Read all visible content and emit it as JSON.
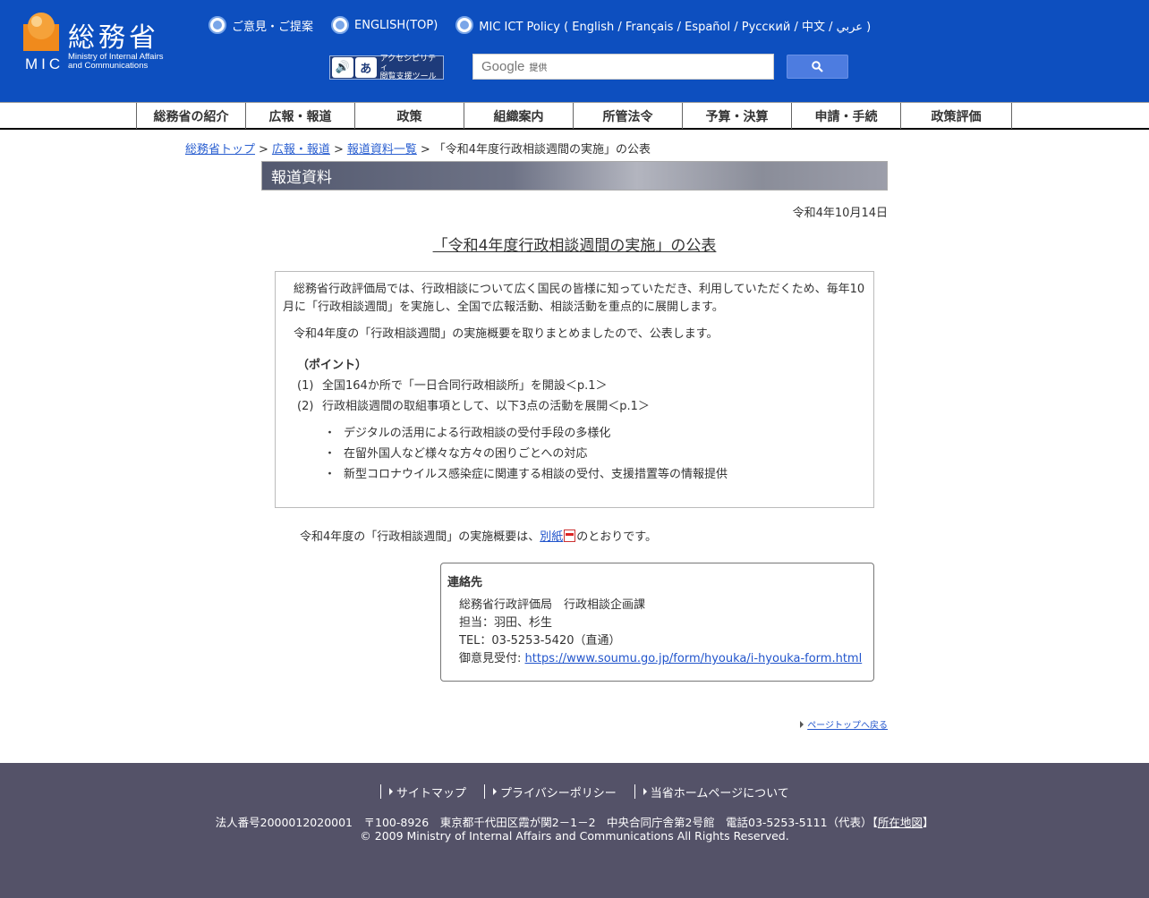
{
  "header": {
    "logo_ja": "総務省",
    "logo_mic": "MIC",
    "logo_en_line1": "Ministry of Internal Affairs",
    "logo_en_line2": "and Communications",
    "links": [
      {
        "label": "ご意見・ご提案"
      },
      {
        "label": "ENGLISH(TOP)"
      },
      {
        "label": "MIC ICT Policy ( English / Français / Español / Русский / 中文 / عربي )"
      }
    ],
    "accessibility_line1": "アクセシビリティ",
    "accessibility_line2": "閲覧支援ツール",
    "search_brand": "Google",
    "search_provided": "提供"
  },
  "nav": {
    "items": [
      {
        "label": "総務省の紹介"
      },
      {
        "label": "広報・報道"
      },
      {
        "label": "政策"
      },
      {
        "label": "組織案内"
      },
      {
        "label": "所管法令"
      },
      {
        "label": "予算・決算"
      },
      {
        "label": "申請・手続"
      },
      {
        "label": "政策評価"
      }
    ]
  },
  "breadcrumb": {
    "items": [
      "総務省トップ",
      "広報・報道",
      "報道資料一覧"
    ],
    "current": "「令和4年度行政相談週間の実施」の公表",
    "separator": ">"
  },
  "page": {
    "section_title": "報道資料",
    "date": "令和4年10月14日",
    "title": "「令和4年度行政相談週間の実施」の公表"
  },
  "body": {
    "para1": "総務省行政評価局では、行政相談について広く国民の皆様に知っていただき、利用していただくため、毎年10月に「行政相談週間」を実施し、全国で広報活動、相談活動を重点的に展開します。",
    "para2": "令和4年度の「行政相談週間」の実施概要を取りまとめましたので、公表します。",
    "points_heading": "（ポイント）",
    "points": [
      {
        "num": "(1)",
        "text": "全国164か所で「一日合同行政相談所」を開設＜p.1＞"
      },
      {
        "num": "(2)",
        "text": "行政相談週間の取組事項として、以下3点の活動を展開＜p.1＞"
      }
    ],
    "sub_items": [
      {
        "dot": "・",
        "text": "デジタルの活用による行政相談の受付手段の多様化"
      },
      {
        "dot": "・",
        "text": "在留外国人など様々な方々の困りごとへの対応"
      },
      {
        "dot": "・",
        "text": "新型コロナウイルス感染症に関連する相談の受付、支援措置等の情報提供"
      }
    ]
  },
  "summary": {
    "before": "令和4年度の「行政相談週間」の実施概要は、",
    "link": "別紙",
    "after": "のとおりです。"
  },
  "contact": {
    "heading": "連絡先",
    "lines": [
      "総務省行政評価局　行政相談企画課",
      "担当：羽田、杉生",
      "TEL：03-5253-5420（直通）"
    ],
    "feedback_label": "御意見受付: ",
    "feedback_url": "https://www.soumu.go.jp/form/hyouka/i-hyouka-form.html"
  },
  "pagetop": "ページトップへ戻る",
  "footer": {
    "links": [
      {
        "label": "サイトマップ"
      },
      {
        "label": "プライバシーポリシー"
      },
      {
        "label": "当省ホームページについて"
      }
    ],
    "address": "法人番号2000012020001　〒100-8926　東京都千代田区霞が関2－1－2　中央合同庁舎第2号館　電話03-5253-5111（代表）",
    "map_open": "【",
    "map_link": "所在地図",
    "map_close": "】",
    "copyright": "© 2009 Ministry of Internal Affairs and Communications All Rights Reserved."
  },
  "colors": {
    "header_bg": "#0d4fbf",
    "footer_bg": "#545268",
    "link": "#2255cc",
    "logo_orange": "#f08a1c"
  }
}
